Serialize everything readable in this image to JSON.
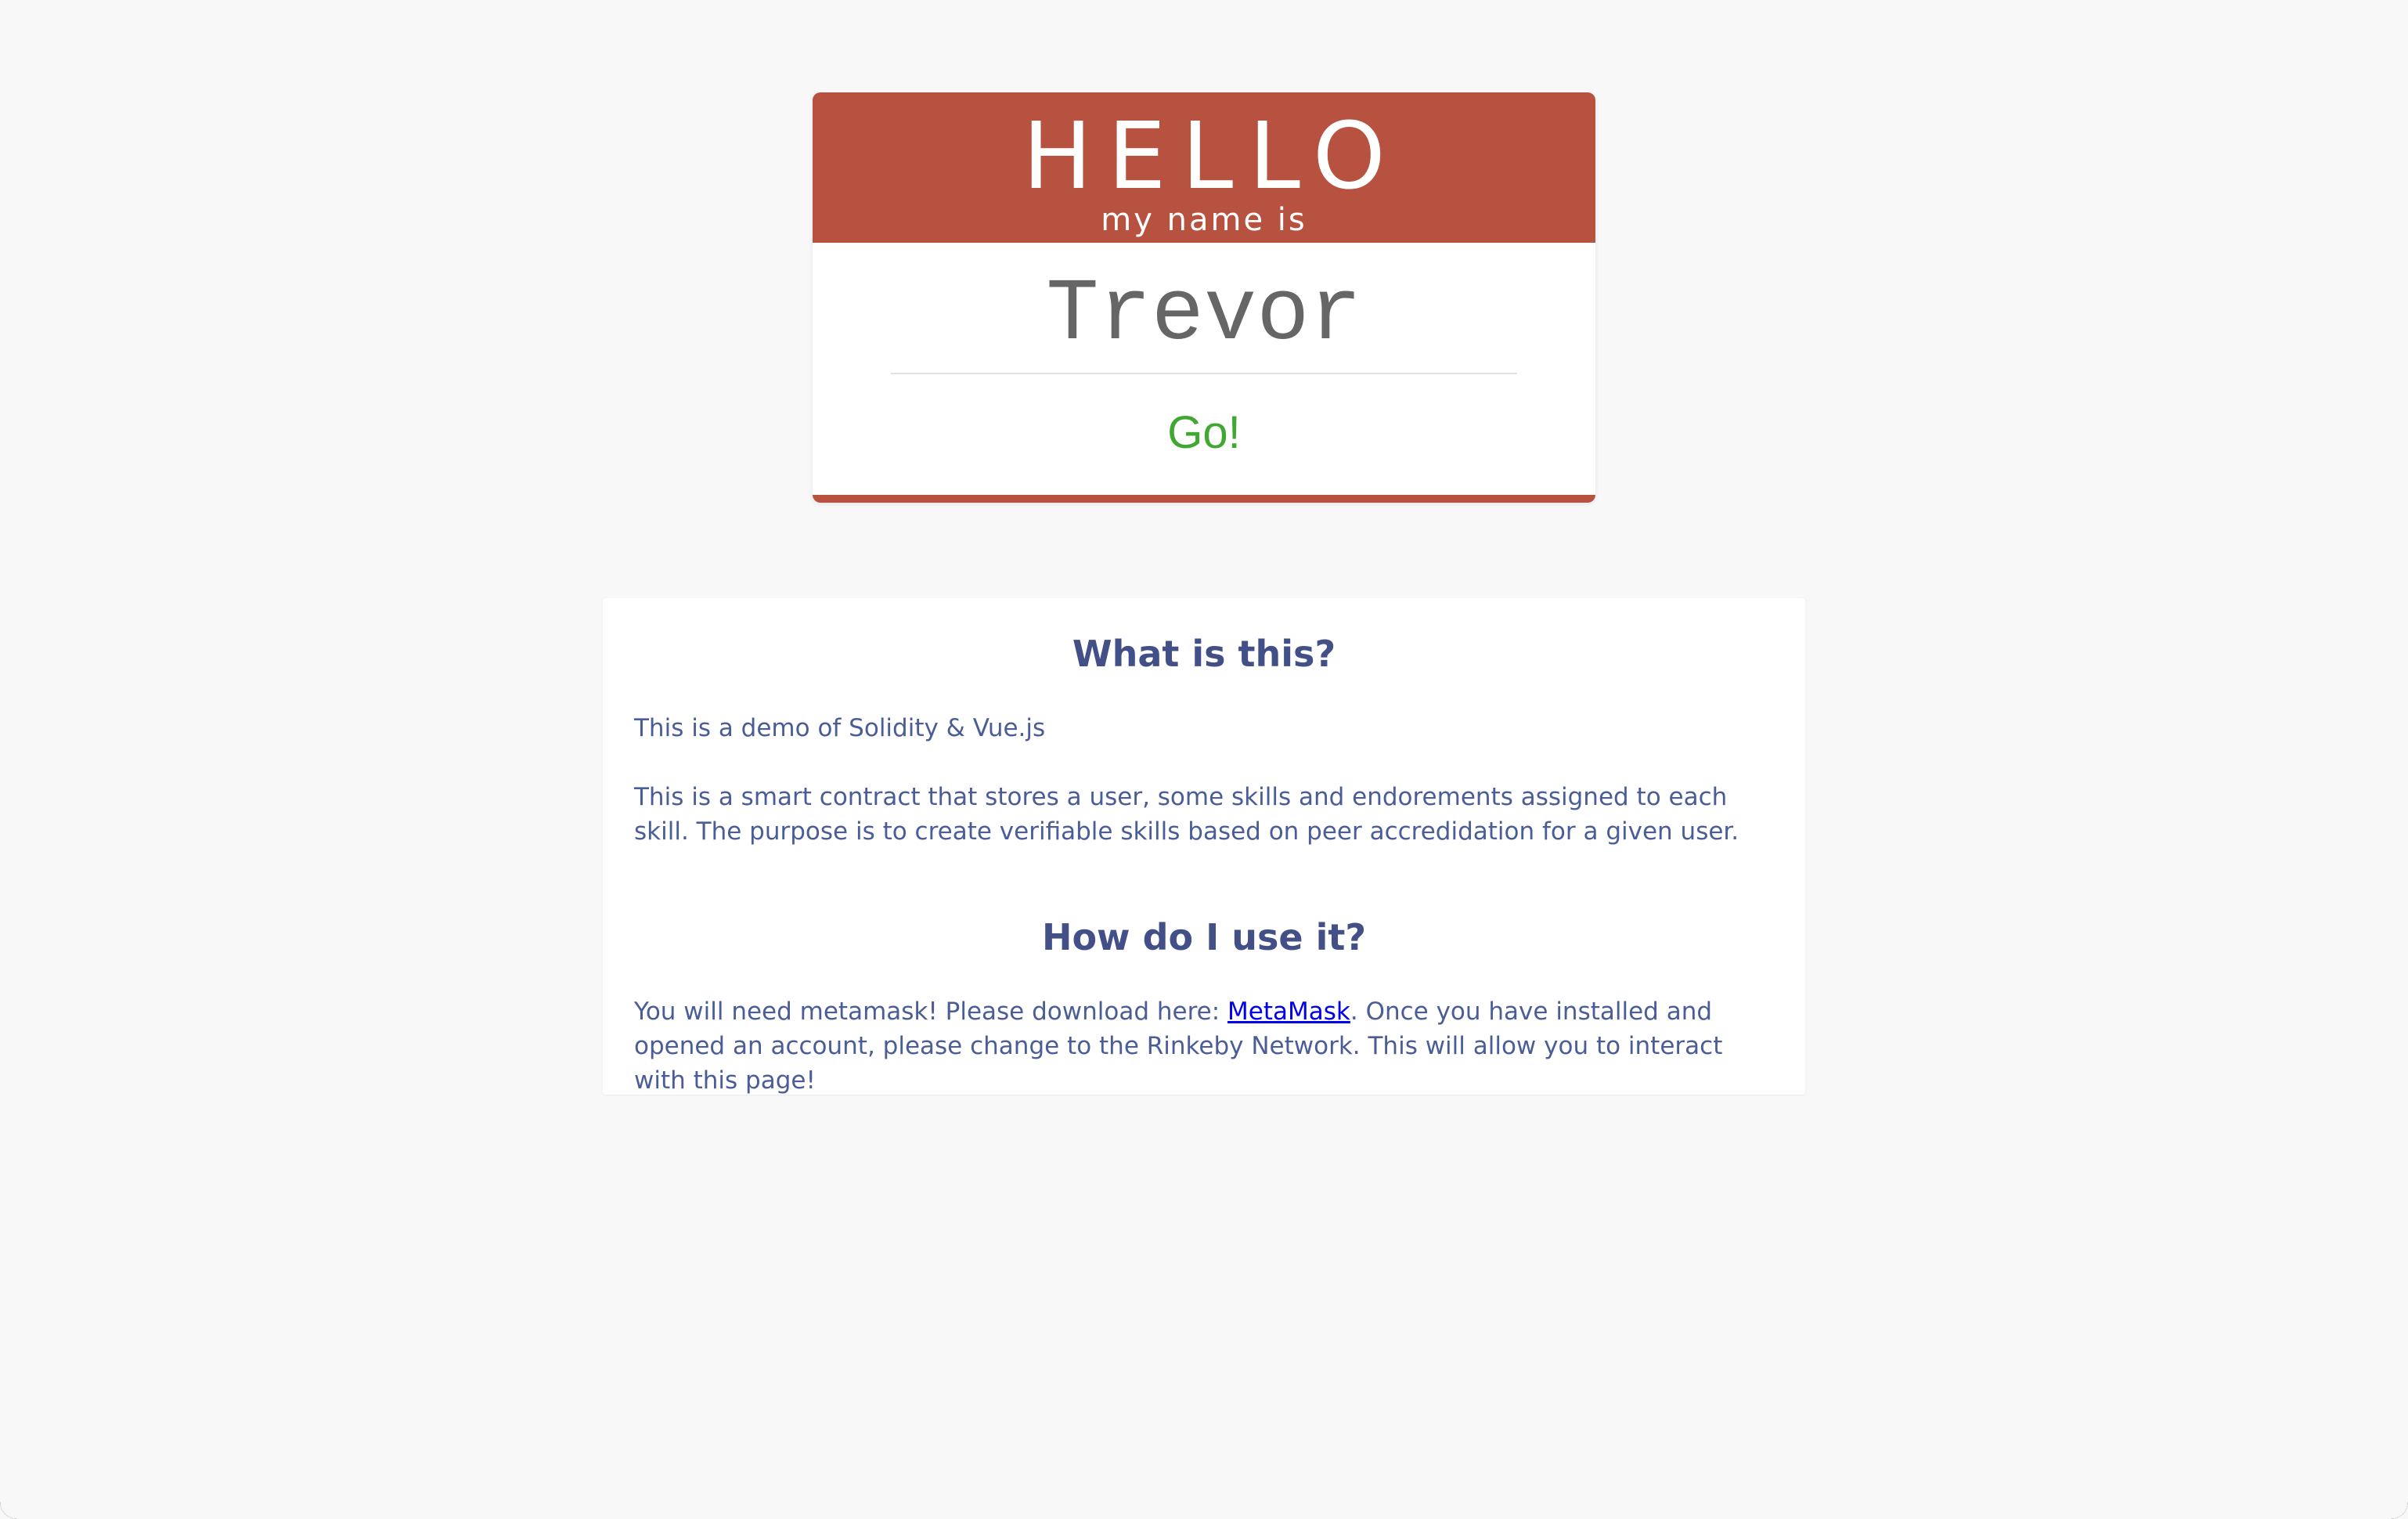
{
  "name_tag": {
    "hello": "HELLO",
    "subtitle": "my name is",
    "name_value": "Trevor",
    "go_label": "Go!"
  },
  "info": {
    "what_heading": "What is this?",
    "demo_text": "This is a demo of Solidity & Vue.js",
    "contract_text": "This is a smart contract that stores a user, some skills and endorements assigned to each skill. The purpose is to create verifiable skills based on peer accredidation for a given user.",
    "how_heading": "How do I use it?",
    "metamask_before": "You will need metamask! Please download here: ",
    "metamask_link": "MetaMask",
    "metamask_after": ". Once you have installed and opened an account, please change to the Rinkeby Network. This will allow you to interact with this page!"
  },
  "colors": {
    "tag_red": "#b85240",
    "go_green": "#40a832",
    "heading_blue": "#435087",
    "text_blue": "#4a5d96",
    "link_blue": "#0000ee",
    "background": "#f8f8f8"
  }
}
